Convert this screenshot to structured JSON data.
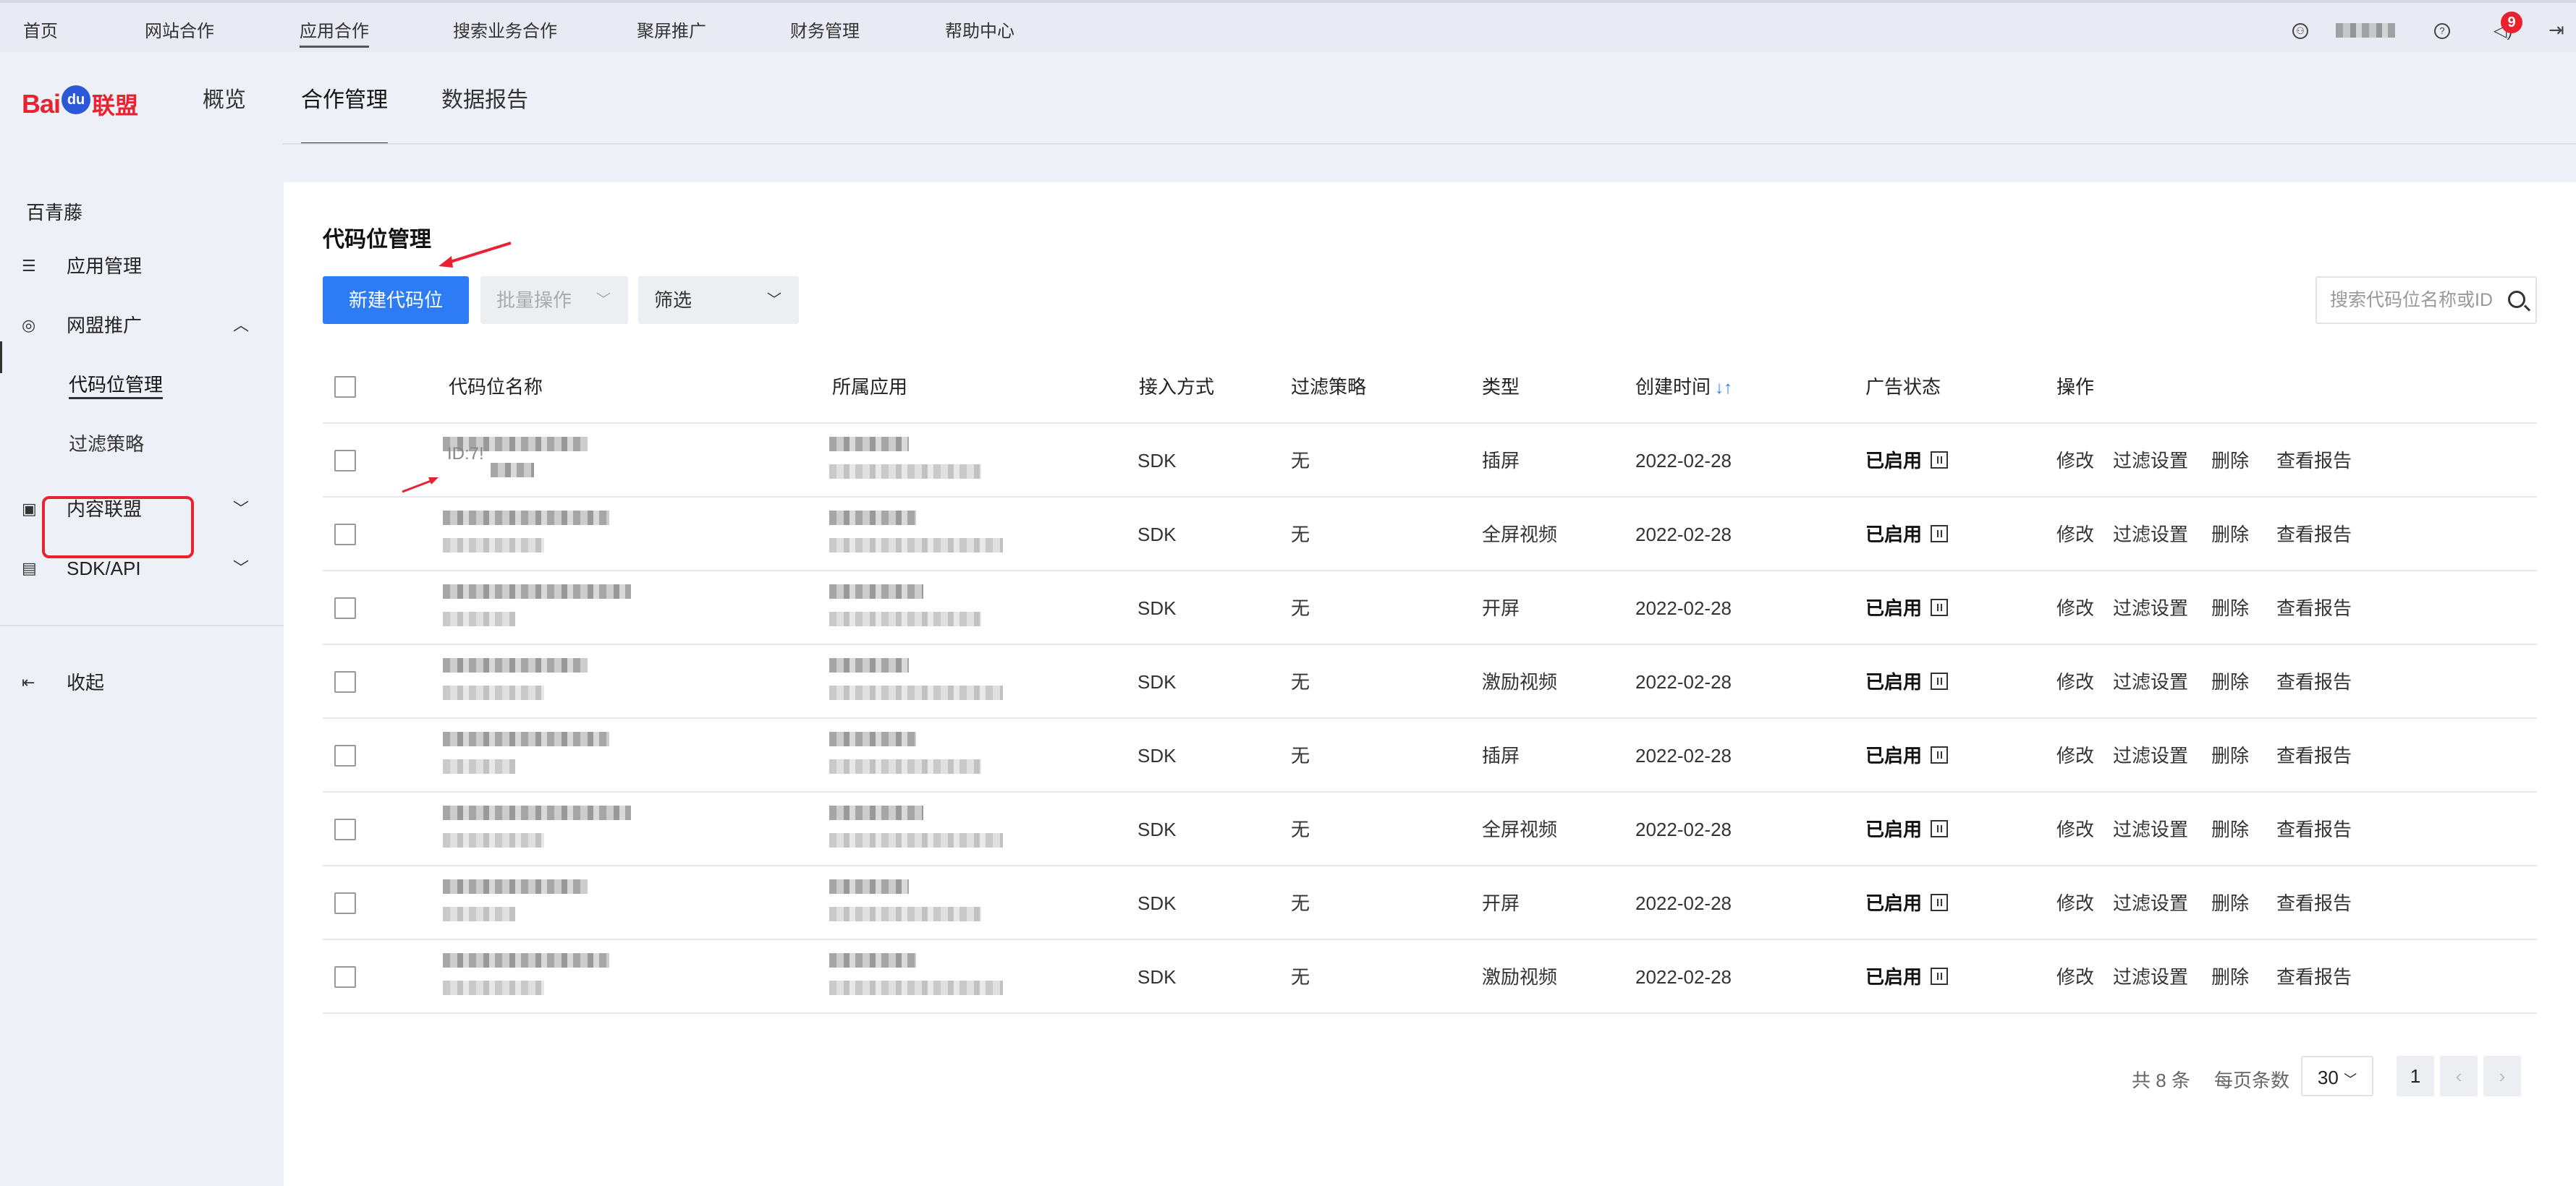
{
  "topnav": {
    "items": [
      "首页",
      "网站合作",
      "应用合作",
      "搜索业务合作",
      "聚屏推广",
      "财务管理",
      "帮助中心"
    ],
    "active_index": 2,
    "notification_count": "9"
  },
  "brand": {
    "logo_text_1": "Bai",
    "logo_text_2": "du",
    "logo_text_3": "联盟"
  },
  "header_tabs": [
    "概览",
    "合作管理",
    "数据报告"
  ],
  "sidebar": {
    "account": "百青藤",
    "items": [
      {
        "label": "应用管理",
        "icon": "app-list-icon"
      },
      {
        "label": "网盟推广",
        "icon": "aperture-icon",
        "expanded": true
      },
      {
        "label": "内容联盟",
        "icon": "chart-icon",
        "expanded": false
      },
      {
        "label": "SDK/API",
        "icon": "folder-code-icon",
        "expanded": false
      }
    ],
    "subitems": [
      "代码位管理",
      "过滤策略"
    ],
    "collapse_label": "收起"
  },
  "main": {
    "title": "代码位管理",
    "new_button": "新建代码位",
    "batch_button": "批量操作",
    "filter_button": "筛选",
    "search_placeholder": "搜索代码位名称或ID",
    "columns": [
      "代码位名称",
      "所属应用",
      "接入方式",
      "过滤策略",
      "类型",
      "创建时间",
      "广告状态",
      "操作"
    ],
    "id_prefix": "ID:7!",
    "rows": [
      {
        "access": "SDK",
        "filter": "无",
        "type": "插屏",
        "created": "2022-02-28",
        "status": "已启用"
      },
      {
        "access": "SDK",
        "filter": "无",
        "type": "全屏视频",
        "created": "2022-02-28",
        "status": "已启用"
      },
      {
        "access": "SDK",
        "filter": "无",
        "type": "开屏",
        "created": "2022-02-28",
        "status": "已启用"
      },
      {
        "access": "SDK",
        "filter": "无",
        "type": "激励视频",
        "created": "2022-02-28",
        "status": "已启用"
      },
      {
        "access": "SDK",
        "filter": "无",
        "type": "插屏",
        "created": "2022-02-28",
        "status": "已启用"
      },
      {
        "access": "SDK",
        "filter": "无",
        "type": "全屏视频",
        "created": "2022-02-28",
        "status": "已启用"
      },
      {
        "access": "SDK",
        "filter": "无",
        "type": "开屏",
        "created": "2022-02-28",
        "status": "已启用"
      },
      {
        "access": "SDK",
        "filter": "无",
        "type": "激励视频",
        "created": "2022-02-28",
        "status": "已启用"
      }
    ],
    "actions": [
      "修改",
      "过滤设置",
      "删除",
      "查看报告"
    ]
  },
  "pagination": {
    "total": "共 8 条",
    "page_size_label": "每页条数",
    "page_size": "30",
    "current_page": "1"
  },
  "colors": {
    "primary": "#2d7cf6",
    "highlight": "#e8222f",
    "background": "#eef0f8"
  }
}
